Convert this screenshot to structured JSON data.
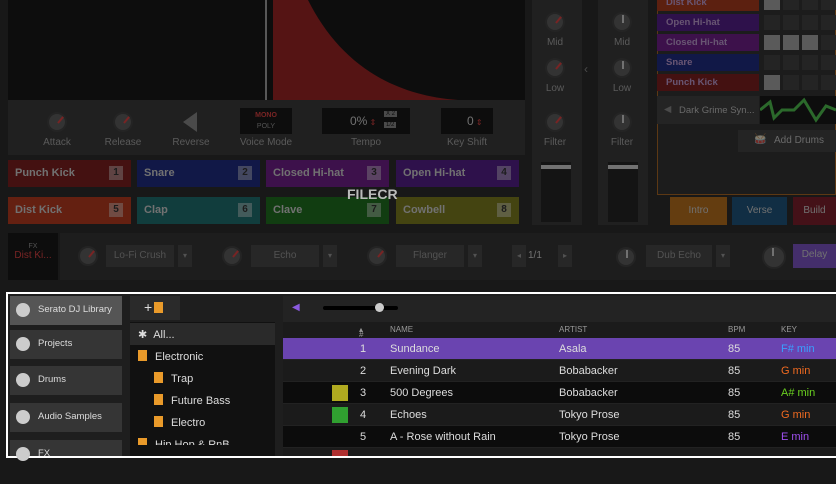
{
  "sampler": {
    "controls": [
      {
        "label": "Attack"
      },
      {
        "label": "Release"
      },
      {
        "label": "Reverse"
      },
      {
        "label": "Voice Mode"
      },
      {
        "label": "Tempo"
      },
      {
        "label": "Key Shift"
      }
    ],
    "voice_mode": {
      "mono": "MONO",
      "poly": "POLY"
    },
    "tempo": {
      "value": "0%",
      "x2": "X 2",
      "half": "1/2"
    },
    "key_shift": "0"
  },
  "pads": [
    {
      "label": "Punch Kick",
      "num": "1",
      "color": "#7a0a0a"
    },
    {
      "label": "Snare",
      "num": "2",
      "color": "#0a1880"
    },
    {
      "label": "Closed Hi-hat",
      "num": "3",
      "color": "#6a0a8a"
    },
    {
      "label": "Open Hi-hat",
      "num": "4",
      "color": "#4a0a8a"
    },
    {
      "label": "Dist Kick",
      "num": "5",
      "color": "#c02a0a"
    },
    {
      "label": "Clap",
      "num": "6",
      "color": "#0a6a6a"
    },
    {
      "label": "Clave",
      "num": "7",
      "color": "#0a6a0a"
    },
    {
      "label": "Cowbell",
      "num": "8",
      "color": "#7a7a0a"
    }
  ],
  "fx": {
    "tag": "FX",
    "target": "Dist Ki...",
    "units": [
      "Lo-Fi Crush",
      "Echo",
      "Flanger"
    ],
    "page": "1/1",
    "deck2": "Dub Echo",
    "deck2b": "Delay"
  },
  "mixer": {
    "labels": [
      "Mid",
      "Low",
      "Filter"
    ]
  },
  "tracks": [
    {
      "label": "Dist Kick",
      "color": "#b02a08"
    },
    {
      "label": "Open Hi-hat",
      "color": "#4a0a8a"
    },
    {
      "label": "Closed Hi-hat",
      "color": "#6a0a8a"
    },
    {
      "label": "Snare",
      "color": "#0a1880"
    },
    {
      "label": "Punch Kick",
      "color": "#7a0a0a"
    }
  ],
  "sample_track": "Dark Grime Syn...",
  "add_drums": "Add Drums",
  "scenes": [
    {
      "label": "Intro",
      "color": "#c06a08"
    },
    {
      "label": "Verse",
      "color": "#0a4a7a"
    },
    {
      "label": "Build",
      "color": "#7a0a1a"
    }
  ],
  "library": {
    "sidebar": [
      {
        "label": "Serato DJ Library",
        "icon": "serato-icon"
      },
      {
        "label": "Projects",
        "icon": "bolt-icon"
      },
      {
        "label": "Drums",
        "icon": "drum-icon"
      },
      {
        "label": "Audio Samples",
        "icon": "waveform-icon"
      },
      {
        "label": "FX",
        "icon": "fx-icon"
      }
    ],
    "add_crate": "+",
    "crates": [
      {
        "label": "All...",
        "indent": 0,
        "icon": "asterisk-icon"
      },
      {
        "label": "Electronic",
        "indent": 0
      },
      {
        "label": "Trap",
        "indent": 1
      },
      {
        "label": "Future Bass",
        "indent": 1
      },
      {
        "label": "Electro",
        "indent": 1
      },
      {
        "label": "Hip Hop & RnB",
        "indent": 0
      }
    ],
    "columns": {
      "num": "#",
      "name": "NAME",
      "artist": "ARTIST",
      "bpm": "BPM",
      "key": "KEY"
    },
    "rows": [
      {
        "num": "1",
        "name": "Sundance",
        "artist": "Asala",
        "bpm": "85",
        "key": "F# min",
        "key_color": "#3aa0ff",
        "swatch": "",
        "selected": true
      },
      {
        "num": "2",
        "name": "Evening Dark",
        "artist": "Bobabacker",
        "bpm": "85",
        "key": "G min",
        "key_color": "#f06a20",
        "swatch": ""
      },
      {
        "num": "3",
        "name": "500 Degrees",
        "artist": "Bobabacker",
        "bpm": "85",
        "key": "A# min",
        "key_color": "#6ad020",
        "swatch": "#b0aa20"
      },
      {
        "num": "4",
        "name": "Echoes",
        "artist": "Tokyo Prose",
        "bpm": "85",
        "key": "G min",
        "key_color": "#f06a20",
        "swatch": "#30a030"
      },
      {
        "num": "5",
        "name": "A - Rose without Rain",
        "artist": "Tokyo Prose",
        "bpm": "85",
        "key": "E min",
        "key_color": "#a050f0",
        "swatch": ""
      }
    ]
  },
  "volume": 0.75
}
